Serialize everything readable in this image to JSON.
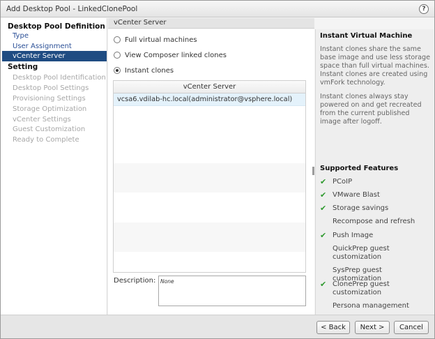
{
  "window": {
    "title": "Add Desktop Pool - LinkedClonePool",
    "help_label": "?"
  },
  "nav": {
    "definition_heading": "Desktop Pool Definition",
    "definition_items": [
      "Type",
      "User Assignment",
      "vCenter Server"
    ],
    "setting_heading": "Setting",
    "setting_items": [
      "Desktop Pool Identification",
      "Desktop Pool Settings",
      "Provisioning Settings",
      "Storage Optimization",
      "vCenter Settings",
      "Guest Customization",
      "Ready to Complete"
    ]
  },
  "center": {
    "header": "vCenter Server",
    "options": [
      "Full virtual machines",
      "View Composer linked clones",
      "Instant clones"
    ],
    "selected_option": "Instant clones",
    "table": {
      "column": "vCenter Server",
      "rows": [
        "vcsa6.vdilab-hc.local(administrator@vsphere.local)"
      ]
    },
    "description_label": "Description:",
    "description_value": "None"
  },
  "info": {
    "title": "Instant Virtual Machine",
    "paragraph1": "Instant clones share the same base image and use less storage space than full virtual machines. Instant clones are created using vmFork technology.",
    "paragraph2": "Instant clones always stay powered on and get recreated from the current published image after logoff.",
    "features_title": "Supported Features",
    "features": [
      {
        "label": "PCoIP",
        "supported": true
      },
      {
        "label": "VMware Blast",
        "supported": true
      },
      {
        "label": "Storage savings",
        "supported": true
      },
      {
        "label": "Recompose and refresh",
        "supported": false
      },
      {
        "label": "Push Image",
        "supported": true
      },
      {
        "label": "QuickPrep guest customization",
        "supported": false
      },
      {
        "label": "SysPrep guest customization",
        "supported": false
      },
      {
        "label": "ClonePrep guest customization",
        "supported": true
      },
      {
        "label": "Persona management",
        "supported": false
      }
    ]
  },
  "footer": {
    "back_label": "< Back",
    "next_label": "Next >",
    "cancel_label": "Cancel"
  },
  "colors": {
    "selected_nav": "#1f4c82",
    "check": "#2f9a2f",
    "link": "#2a4f96"
  }
}
